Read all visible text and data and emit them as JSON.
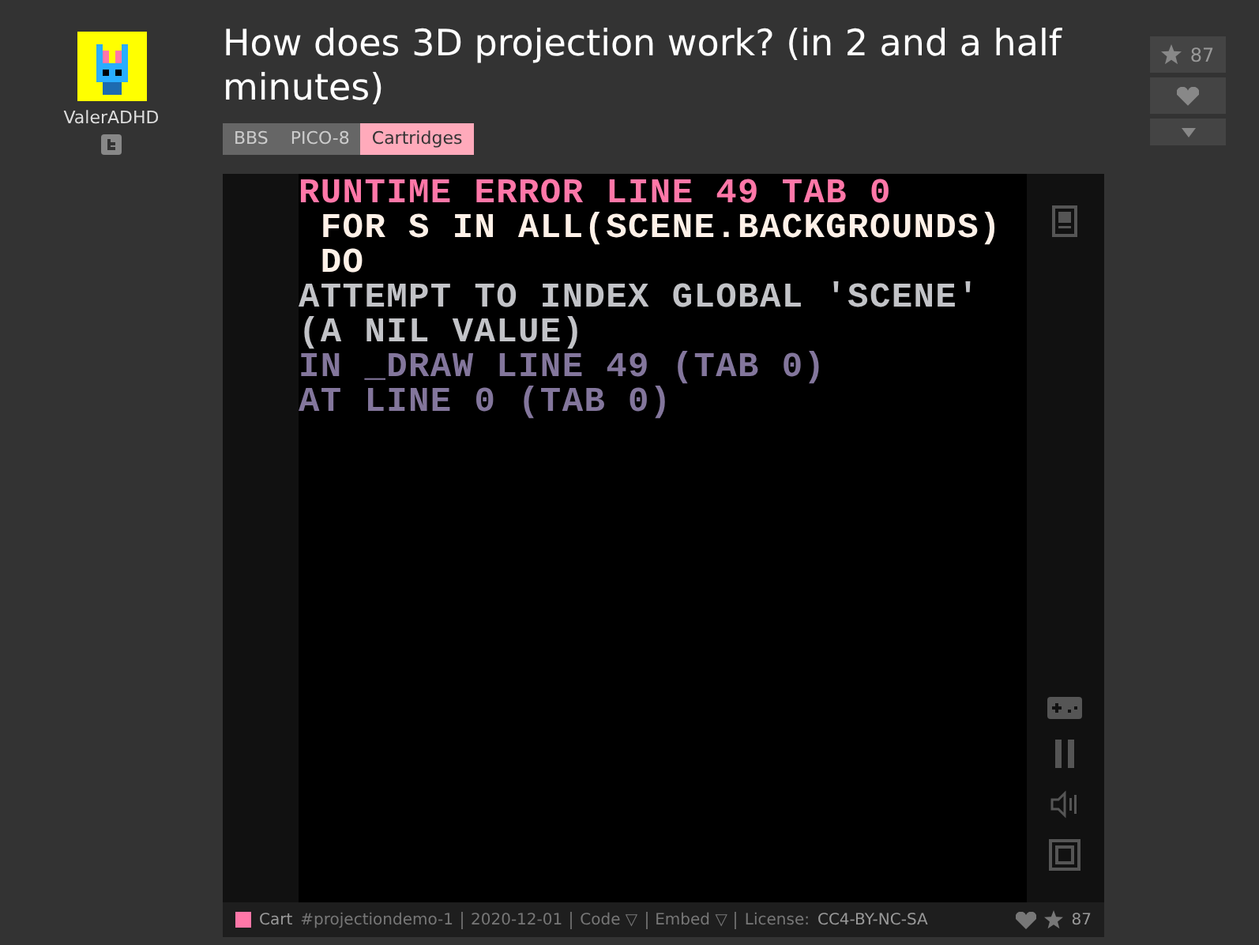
{
  "author": {
    "name": "ValerADHD"
  },
  "post": {
    "title": "How does 3D projection work? (in 2 and a half minutes)",
    "breadcrumbs": [
      {
        "label": "BBS",
        "selected": false
      },
      {
        "label": "PICO-8",
        "selected": false
      },
      {
        "label": "Cartridges",
        "selected": true
      }
    ]
  },
  "votes": {
    "stars": "87"
  },
  "console": {
    "lines": [
      {
        "text": "RUNTIME ERROR LINE 49 TAB 0",
        "color": "#ff77a8"
      },
      {
        "text": " FOR S IN ALL(SCENE.BACKGROUNDS)",
        "color": "#fff1e8"
      },
      {
        "text": " DO",
        "color": "#fff1e8"
      },
      {
        "text": "ATTEMPT TO INDEX GLOBAL 'SCENE'",
        "color": "#c2c3c7"
      },
      {
        "text": "(A NIL VALUE)",
        "color": "#c2c3c7"
      },
      {
        "text": "IN _DRAW LINE 49 (TAB 0)",
        "color": "#83769c"
      },
      {
        "text": "AT LINE 0 (TAB 0)",
        "color": "#83769c"
      }
    ]
  },
  "footer": {
    "items": [
      "Cart",
      "#projectiondemo-1",
      "2020-12-01",
      "Code ▽",
      "Embed ▽",
      "License:",
      "CC4-BY-NC-SA"
    ],
    "stars": "87"
  }
}
